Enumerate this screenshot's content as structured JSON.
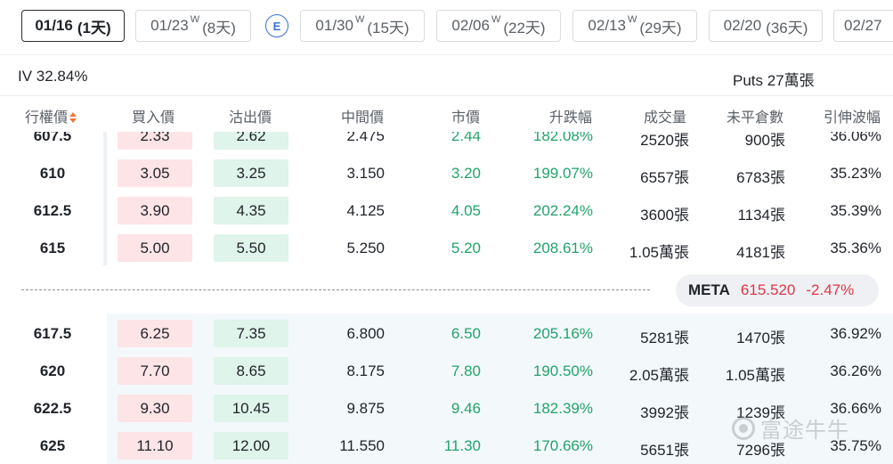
{
  "tabs": [
    {
      "date": "01/16",
      "weekly": "",
      "days": "(1天)",
      "active": true
    },
    {
      "date": "01/23",
      "weekly": "W",
      "days": "(8天)",
      "active": false
    },
    {
      "date": "01/30",
      "weekly": "W",
      "days": "(15天)",
      "active": false
    },
    {
      "date": "02/06",
      "weekly": "W",
      "days": "(22天)",
      "active": false
    },
    {
      "date": "02/13",
      "weekly": "W",
      "days": "(29天)",
      "active": false
    },
    {
      "date": "02/20",
      "weekly": "",
      "days": "(36天)",
      "active": false
    },
    {
      "date": "02/27",
      "weekly": "",
      "days": "",
      "active": false
    }
  ],
  "earnings_badge": "E",
  "iv_label": "IV 32.84%",
  "puts_label": "Puts 27萬張",
  "columns": {
    "strike": "行權價",
    "bid": "買入價",
    "ask": "沽出價",
    "mid": "中間價",
    "last": "市價",
    "change": "升跌幅",
    "volume": "成交量",
    "open_interest": "未平倉數",
    "iv": "引伸波幅"
  },
  "rows_above": [
    {
      "strike": "607.5",
      "bid": "2.33",
      "ask": "2.62",
      "mid": "2.475",
      "last": "2.44",
      "change": "182.08%",
      "volume": "2520張",
      "oi": "900張",
      "iv": "36.06%"
    },
    {
      "strike": "610",
      "bid": "3.05",
      "ask": "3.25",
      "mid": "3.150",
      "last": "3.20",
      "change": "199.07%",
      "volume": "6557張",
      "oi": "6783張",
      "iv": "35.23%"
    },
    {
      "strike": "612.5",
      "bid": "3.90",
      "ask": "4.35",
      "mid": "4.125",
      "last": "4.05",
      "change": "202.24%",
      "volume": "3600張",
      "oi": "1134張",
      "iv": "35.39%"
    },
    {
      "strike": "615",
      "bid": "5.00",
      "ask": "5.50",
      "mid": "5.250",
      "last": "5.20",
      "change": "208.61%",
      "volume": "1.05萬張",
      "oi": "4181張",
      "iv": "35.36%"
    }
  ],
  "quote": {
    "symbol": "META",
    "price": "615.520",
    "change": "-2.47%"
  },
  "rows_below": [
    {
      "strike": "617.5",
      "bid": "6.25",
      "ask": "7.35",
      "mid": "6.800",
      "last": "6.50",
      "change": "205.16%",
      "volume": "5281張",
      "oi": "1470張",
      "iv": "36.92%"
    },
    {
      "strike": "620",
      "bid": "7.70",
      "ask": "8.65",
      "mid": "8.175",
      "last": "7.80",
      "change": "190.50%",
      "volume": "2.05萬張",
      "oi": "1.05萬張",
      "iv": "36.26%"
    },
    {
      "strike": "622.5",
      "bid": "9.30",
      "ask": "10.45",
      "mid": "9.875",
      "last": "9.46",
      "change": "182.39%",
      "volume": "3992張",
      "oi": "1239張",
      "iv": "36.66%"
    },
    {
      "strike": "625",
      "bid": "11.10",
      "ask": "12.00",
      "mid": "11.550",
      "last": "11.30",
      "change": "170.66%",
      "volume": "5651張",
      "oi": "7296張",
      "iv": "35.75%"
    }
  ],
  "watermark": "富途牛牛",
  "colors": {
    "up": "#22a36b",
    "down": "#e0364a",
    "bid_bg": "#fde4e6",
    "ask_bg": "#dff4ea",
    "sort_accent": "#f07a3a",
    "earnings": "#3a6fd8"
  }
}
